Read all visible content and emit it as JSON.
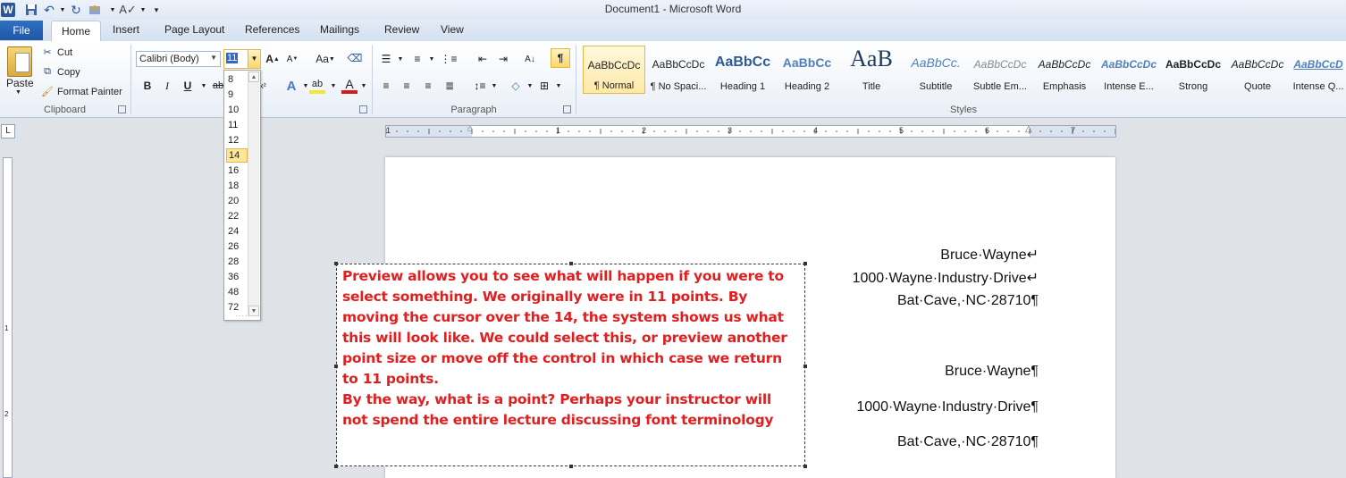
{
  "window": {
    "title": "Document1 - Microsoft Word"
  },
  "quick_access": {
    "app_icon": "W",
    "items": [
      "save-icon",
      "undo-icon",
      "redo-icon",
      "customize-icon",
      "spelling-icon",
      "quick-access-menu-icon"
    ]
  },
  "tabs": {
    "file": "File",
    "items": [
      "Home",
      "Insert",
      "Page Layout",
      "References",
      "Mailings",
      "Review",
      "View"
    ],
    "active": "Home"
  },
  "clipboard": {
    "paste": "Paste",
    "cut": "Cut",
    "copy": "Copy",
    "format_painter": "Format Painter",
    "label": "Clipboard"
  },
  "font": {
    "name": "Calibri (Body)",
    "size": "11",
    "bold": "B",
    "italic": "I",
    "underline": "U",
    "change_case": "Aa",
    "grow": "A",
    "shrink": "A"
  },
  "font_size_list": {
    "options": [
      "8",
      "9",
      "10",
      "11",
      "12",
      "14",
      "16",
      "18",
      "20",
      "22",
      "24",
      "26",
      "28",
      "36",
      "48",
      "72"
    ],
    "highlighted": "14"
  },
  "paragraph": {
    "label": "Paragraph",
    "show_marks": "¶"
  },
  "styles": {
    "label": "Styles",
    "items": [
      {
        "sample": "AaBbCcDc",
        "name": "¶ Normal"
      },
      {
        "sample": "AaBbCcDc",
        "name": "¶ No Spaci..."
      },
      {
        "sample": "AaBbCc",
        "name": "Heading 1"
      },
      {
        "sample": "AaBbCc",
        "name": "Heading 2"
      },
      {
        "sample": "AaB",
        "name": "Title"
      },
      {
        "sample": "AaBbCc.",
        "name": "Subtitle"
      },
      {
        "sample": "AaBbCcDc",
        "name": "Subtle Em..."
      },
      {
        "sample": "AaBbCcDc",
        "name": "Emphasis"
      },
      {
        "sample": "AaBbCcDc",
        "name": "Intense E..."
      },
      {
        "sample": "AaBbCcDc",
        "name": "Strong"
      },
      {
        "sample": "AaBbCcDc",
        "name": "Quote"
      },
      {
        "sample": "AaBbCcD",
        "name": "Intense Q..."
      }
    ],
    "selected": "¶ Normal"
  },
  "ruler": {
    "numbers": [
      "1",
      "1",
      "2",
      "3",
      "4",
      "5",
      "6",
      "7"
    ]
  },
  "vertical_ruler": {
    "numbers": [
      "1",
      "2"
    ]
  },
  "document": {
    "address_block_1": [
      "Bruce·Wayne↵",
      "1000·Wayne·Industry·Drive↵",
      "Bat·Cave,·NC·28710¶"
    ],
    "address_block_2": [
      "Bruce·Wayne¶",
      "1000·Wayne·Industry·Drive¶",
      "Bat·Cave,·NC·28710¶"
    ]
  },
  "textbox": {
    "paragraph_1": "Preview allows you to see what will happen if you were to select something. We originally were in 11 points. By moving the cursor over the 14, the system shows us what this will look like. We could select this, or preview another point size or move off the control in which case we return to 11 points.",
    "paragraph_2": "By the way, what is a point? Perhaps your instructor will not spend the entire lecture discussing font terminology",
    "color": "#e02020"
  }
}
